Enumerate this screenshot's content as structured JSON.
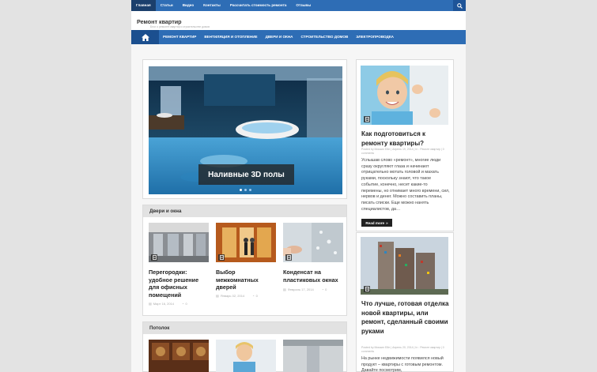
{
  "top_nav": {
    "items": [
      "Главная",
      "Статьи",
      "Видео",
      "Контакты",
      "Рассчитать стоимость ремонта",
      "Отзывы"
    ]
  },
  "header": {
    "site_title": "Ремонт квартир",
    "site_desc": "Блог о ремонте квартир и строительстве домов"
  },
  "main_nav": {
    "items": [
      "РЕМОНТ КВАРТИР",
      "ВЕНТИЛЯЦИЯ И ОТОПЛЕНИЕ",
      "ДВЕРИ И ОКНА",
      "СТРОИТЕЛЬСТВО ДОМОВ",
      "ЭЛЕКТРОПРОВОДКА"
    ]
  },
  "slider": {
    "caption": "Наливные 3D полы"
  },
  "sections": [
    {
      "title": "Двери и окна",
      "cards": [
        {
          "title": "Перегородки: удобное решение для офисных помещений",
          "date": "Март 16, 2014",
          "comments": "0"
        },
        {
          "title": "Выбор межкомнатных дверей",
          "date": "Январь 02, 2014",
          "comments": "0"
        },
        {
          "title": "Конденсат на пластиковых окнах",
          "date": "Февраль 17, 2014",
          "comments": "0"
        }
      ]
    },
    {
      "title": "Потолок"
    }
  ],
  "sidebar": {
    "post1": {
      "title": "Как подготовиться к ремонту квартиры?",
      "meta": "Posted by Михаил Ейн  |  Апрель 19, 2014  |  In : Ремонт квартир  |  0 comments",
      "excerpt": "Услышав слово «ремонт», многие люди сразу округляют глаза и начинают отрицательно мотать головой и махать руками, поскольку знают, что такое событие, конечно, несет какие-то перемены, но отнимает много времени, сил, нервов и денег. Можно составить планы, писать списки. Еще можно нанять специалистов, да…",
      "read_more": "Read more"
    },
    "post2": {
      "title": "Что лучше, готовая отделка новой квартиры, или ремонт, сделанный своими руками",
      "meta": "Posted by Михаил Ейн  |  Апрель 20, 2014  |  In : Ремонт квартир  |  0 comments",
      "excerpt": "На рынке недвижимости появился новый продукт – квартиры с готовым ремонтом. Давайте посмотрим,"
    }
  },
  "colors": {
    "primary_blue": "#2e6db5",
    "dark_blue": "#1b3f6c",
    "page_bg": "#e3e3e3"
  }
}
